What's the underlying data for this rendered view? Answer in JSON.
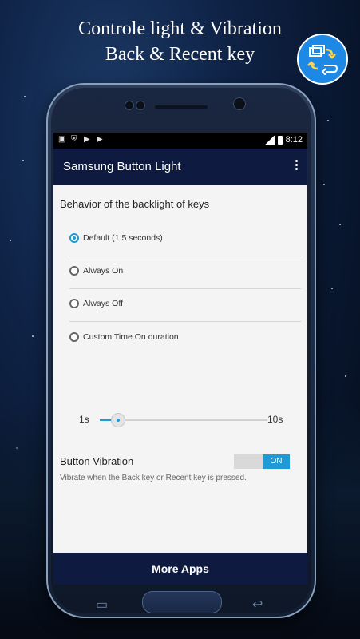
{
  "promo": {
    "headline_line1": "Controle light & Vibration",
    "headline_line2": "Back & Recent key",
    "badge_icon": "recent-back-swap-icon",
    "accent_color": "#1e9ad6"
  },
  "statusbar": {
    "icons": [
      "image-icon",
      "shield-icon",
      "play-icon",
      "play-icon"
    ],
    "time": "8:12"
  },
  "appbar": {
    "title": "Samsung Button Light",
    "menu_icon": "more-vert-icon"
  },
  "settings": {
    "behavior_title": "Behavior of the backlight of keys",
    "options": [
      {
        "label": "Default (1.5 seconds)",
        "selected": true
      },
      {
        "label": "Always On",
        "selected": false
      },
      {
        "label": "Always Off",
        "selected": false
      },
      {
        "label": "Custom Time On duration",
        "selected": false
      }
    ],
    "slider": {
      "min_label": "1s",
      "max_label": "10s",
      "value": 1.5
    },
    "vibration": {
      "title": "Button Vibration",
      "description": "Vibrate when the Back key or Recent key is pressed.",
      "toggle_label": "ON",
      "enabled": true
    }
  },
  "bottom_button": {
    "label": "More Apps"
  }
}
